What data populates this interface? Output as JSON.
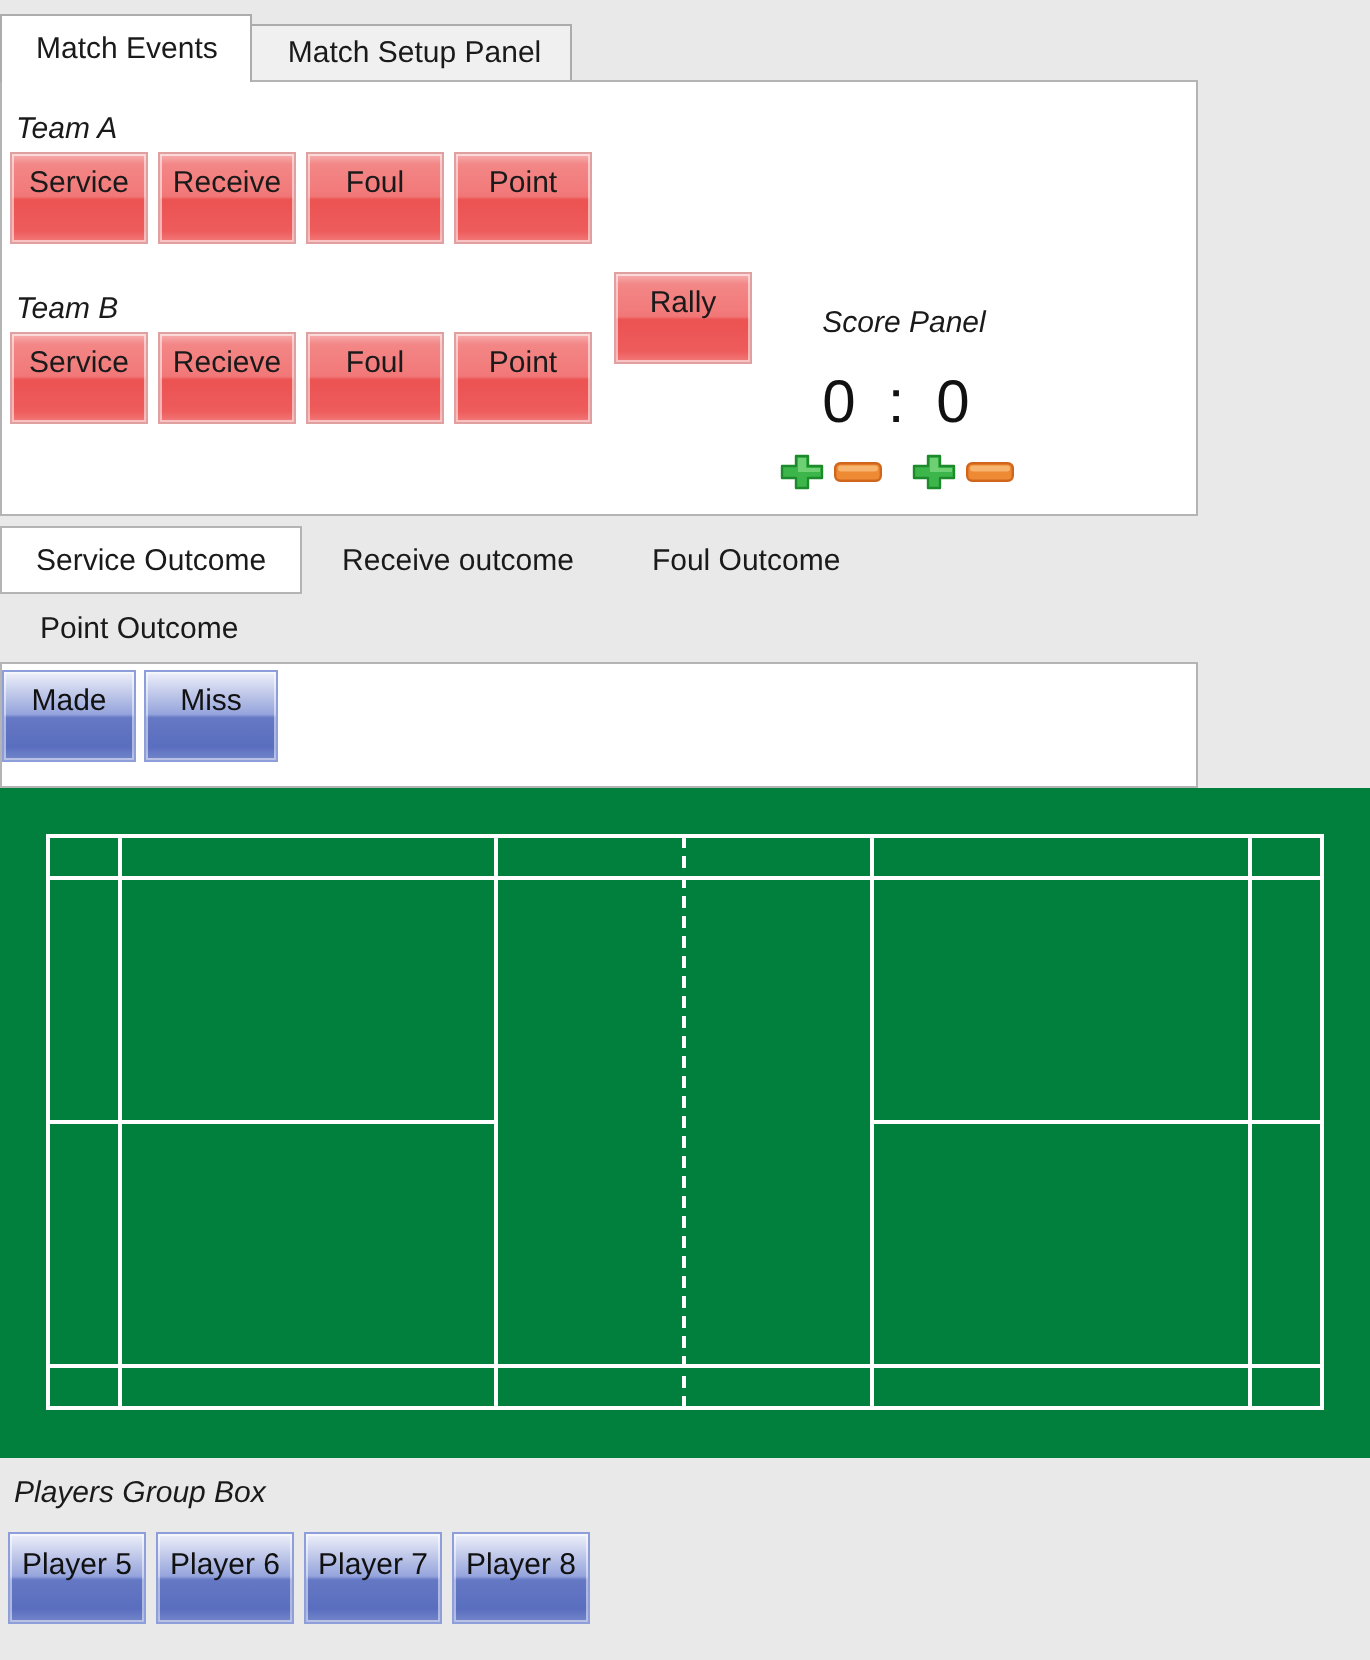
{
  "tabs": [
    {
      "label": "Match Events",
      "selected": true
    },
    {
      "label": "Match Setup Panel",
      "selected": false
    }
  ],
  "match_events": {
    "teams": [
      {
        "label": "Team A",
        "buttons": [
          "Service",
          "Receive",
          "Foul",
          "Point"
        ]
      },
      {
        "label": "Team B",
        "buttons": [
          "Service",
          "Recieve",
          "Foul",
          "Point"
        ]
      }
    ],
    "rally_button": "Rally",
    "score_panel": {
      "title": "Score Panel",
      "scores": [
        "0",
        "0"
      ],
      "separator": ":"
    }
  },
  "outcome_tabs": [
    {
      "label": "Service Outcome",
      "selected": true
    },
    {
      "label": "Receive outcome",
      "selected": false
    },
    {
      "label": "Foul Outcome",
      "selected": false
    },
    {
      "label": "Point Outcome",
      "selected": false
    }
  ],
  "outcome_buttons": [
    "Made",
    "Miss"
  ],
  "players_group": {
    "title": "Players Group Box",
    "buttons": [
      "Player 5",
      "Player 6",
      "Player 7",
      "Player 8"
    ]
  }
}
